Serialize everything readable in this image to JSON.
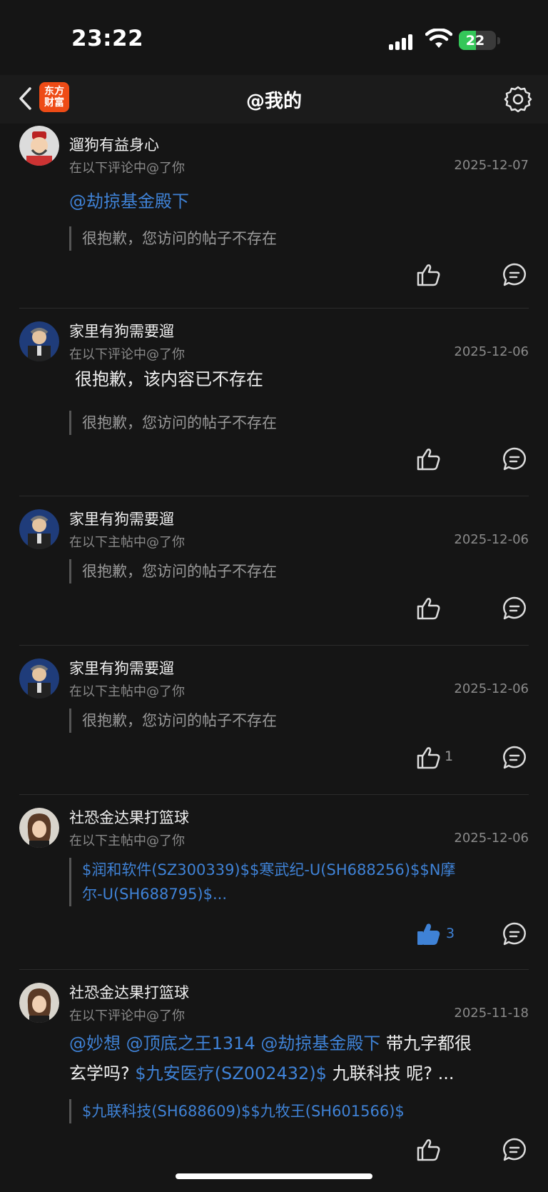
{
  "status": {
    "time": "23:22",
    "battery": "22"
  },
  "nav": {
    "logo_line1": "东方",
    "logo_line2": "财富",
    "title": "@我的"
  },
  "items": [
    {
      "username": "遛狗有益身心",
      "subtitle": "在以下评论中@了你",
      "date": "2025-12-07",
      "body": "@劫掠基金殿下",
      "quote": "很抱歉，您访问的帖子不存在",
      "likes": ""
    },
    {
      "username": "家里有狗需要遛",
      "subtitle": "在以下评论中@了你",
      "date": "2025-12-06",
      "body": "很抱歉，该内容已不存在",
      "quote": "很抱歉，您访问的帖子不存在",
      "likes": ""
    },
    {
      "username": "家里有狗需要遛",
      "subtitle": "在以下主帖中@了你",
      "date": "2025-12-06",
      "quote": "很抱歉，您访问的帖子不存在",
      "likes": ""
    },
    {
      "username": "家里有狗需要遛",
      "subtitle": "在以下主帖中@了你",
      "date": "2025-12-06",
      "quote": "很抱歉，您访问的帖子不存在",
      "likes": "1"
    },
    {
      "username": "社恐金达果打篮球",
      "subtitle": "在以下主帖中@了你",
      "date": "2025-12-06",
      "quote_line1": "$润和软件(SZ300339)$$寒武纪-U(SH688256)$$N摩",
      "quote_line2": "尔-U(SH688795)$...",
      "likes": "3"
    },
    {
      "username": "社恐金达果打篮球",
      "subtitle": "在以下评论中@了你",
      "date": "2025-11-18",
      "body_mention1": "@妙想",
      "body_mention2": "@顶底之王1314",
      "body_mention3": "@劫掠基金殿下",
      "body_text1": "带九字都很",
      "body_text2": "玄学吗?",
      "body_stock": "$九安医疗(SZ002432)$",
      "body_text3": "九联科技 呢? ...",
      "quote": "$九联科技(SH688609)$$九牧王(SH601566)$",
      "likes": ""
    }
  ],
  "icons": {
    "back": "chevron-left-icon",
    "settings": "gear-icon",
    "like": "thumbs-up-icon",
    "comment": "comment-icon"
  },
  "colors": {
    "link": "#3f82d6",
    "background": "#151515",
    "logo": "#ee4b16",
    "battery": "#34c759"
  }
}
